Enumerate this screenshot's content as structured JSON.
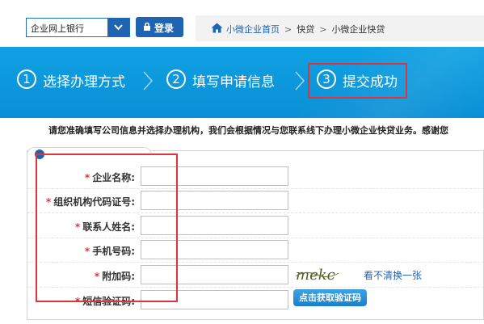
{
  "header": {
    "bank_select_value": "企业网上银行",
    "login_label": "登录",
    "breadcrumb": [
      "小微企业首页",
      "快贷",
      "小微企业快贷"
    ],
    "breadcrumb_sep": ">"
  },
  "steps": [
    {
      "num": "1",
      "label": "选择办理方式"
    },
    {
      "num": "2",
      "label": "填写申请信息"
    },
    {
      "num": "3",
      "label": "提交成功"
    }
  ],
  "notice": "请您准确填写公司信息并选择办理机构，我们会根据情况与您联系线下办理小微企业快贷业务。感谢您",
  "form": {
    "required_mark": "*",
    "fields": [
      {
        "label": "企业名称:",
        "value": ""
      },
      {
        "label": "组织机构代码证号:",
        "value": ""
      },
      {
        "label": "联系人姓名:",
        "value": ""
      },
      {
        "label": "手机号码:",
        "value": ""
      },
      {
        "label": "附加码:",
        "value": ""
      },
      {
        "label": "短信验证码:",
        "value": ""
      }
    ],
    "captcha_text": "mekc",
    "refresh_label": "看不清换一张",
    "sms_button": "点击获取验证码"
  },
  "colors": {
    "brand_blue": "#1f63b3",
    "banner_blue": "#0fa1e3",
    "highlight_red": "#d9363e"
  }
}
